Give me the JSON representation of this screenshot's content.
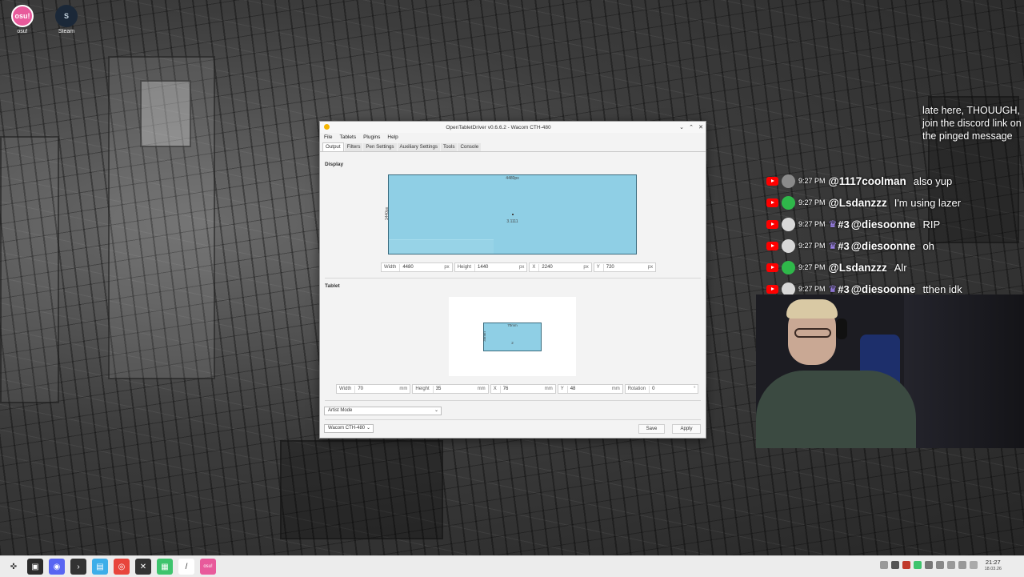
{
  "desktop": {
    "icons": [
      {
        "label": "osu!",
        "glyph": "osu!"
      },
      {
        "label": "Steam",
        "glyph": "S"
      }
    ]
  },
  "window": {
    "title": "OpenTabletDriver v0.6.6.2 - Wacom CTH-480",
    "controls": {
      "minimize": "⌄",
      "maximize": "⌃",
      "close": "✕"
    },
    "menu": [
      "File",
      "Tablets",
      "Plugins",
      "Help"
    ],
    "tabs": [
      "Output",
      "Filters",
      "Pen Settings",
      "Auxiliary Settings",
      "Tools",
      "Console"
    ],
    "active_tab": "Output",
    "display": {
      "section": "Display",
      "area_width_caption": "4480px",
      "area_height_caption": "1440px",
      "aspect_caption": "3.1111",
      "fields": [
        {
          "label": "Width",
          "value": "4480",
          "unit": "px"
        },
        {
          "label": "Height",
          "value": "1440",
          "unit": "px"
        },
        {
          "label": "X",
          "value": "2240",
          "unit": "px"
        },
        {
          "label": "Y",
          "value": "720",
          "unit": "px"
        }
      ]
    },
    "tablet": {
      "section": "Tablet",
      "area_width_caption": "70mm",
      "area_height_caption": "35mm",
      "aspect_caption": "2",
      "fields": [
        {
          "label": "Width",
          "value": "70",
          "unit": "mm"
        },
        {
          "label": "Height",
          "value": "35",
          "unit": "mm"
        },
        {
          "label": "X",
          "value": "76",
          "unit": "mm"
        },
        {
          "label": "Y",
          "value": "48",
          "unit": "mm"
        },
        {
          "label": "Rotation",
          "value": "0",
          "unit": "°"
        }
      ]
    },
    "output_mode": "Artist Mode",
    "tablet_select": "Wacom CTH-480",
    "save_label": "Save",
    "apply_label": "Apply"
  },
  "chat": {
    "top_message": "late here, THOUUGH, join the discord link on the pinged message",
    "messages": [
      {
        "time": "9:27 PM",
        "badge": "",
        "user": "@1117coolman",
        "text": "also yup",
        "avatar_color": "#8a8a8a"
      },
      {
        "time": "9:27 PM",
        "badge": "",
        "user": "@Lsdanzzz",
        "text": "I'm using lazer",
        "avatar_color": "#2fb84a"
      },
      {
        "time": "9:27 PM",
        "badge": "#3",
        "user": "@diesoonne",
        "text": "RIP",
        "avatar_color": "#d8d8d8"
      },
      {
        "time": "9:27 PM",
        "badge": "#3",
        "user": "@diesoonne",
        "text": "oh",
        "avatar_color": "#d8d8d8"
      },
      {
        "time": "9:27 PM",
        "badge": "",
        "user": "@Lsdanzzz",
        "text": "Alr",
        "avatar_color": "#2fb84a"
      },
      {
        "time": "9:27 PM",
        "badge": "#3",
        "user": "@diesoonne",
        "text": "tthen idk",
        "avatar_color": "#d8d8d8"
      }
    ]
  },
  "taskbar": {
    "apps": [
      {
        "name": "launcher-icon",
        "glyph": "✜",
        "bg": "#ececec",
        "fg": "#333"
      },
      {
        "name": "terminal-icon",
        "glyph": "▣",
        "bg": "#2b2b2b",
        "fg": "#fff"
      },
      {
        "name": "discord-icon",
        "glyph": "◉",
        "bg": "#5865f2",
        "fg": "#fff"
      },
      {
        "name": "console-icon",
        "glyph": "›",
        "bg": "#333",
        "fg": "#fff"
      },
      {
        "name": "files-icon",
        "glyph": "▤",
        "bg": "#3daee9",
        "fg": "#fff"
      },
      {
        "name": "chrome-icon",
        "glyph": "◎",
        "bg": "#e8453c",
        "fg": "#fff"
      },
      {
        "name": "obs-icon",
        "glyph": "✕",
        "bg": "#333",
        "fg": "#fff"
      },
      {
        "name": "tablet-driver-icon",
        "glyph": "▦",
        "bg": "#3ec46d",
        "fg": "#fff"
      },
      {
        "name": "editor-icon",
        "glyph": "/",
        "bg": "#fff",
        "fg": "#333"
      },
      {
        "name": "osu-taskbar-icon",
        "glyph": "osu!",
        "bg": "#e85a9b",
        "fg": "#fff"
      }
    ],
    "clock_time": "21:27",
    "clock_date": "18.03.26"
  }
}
